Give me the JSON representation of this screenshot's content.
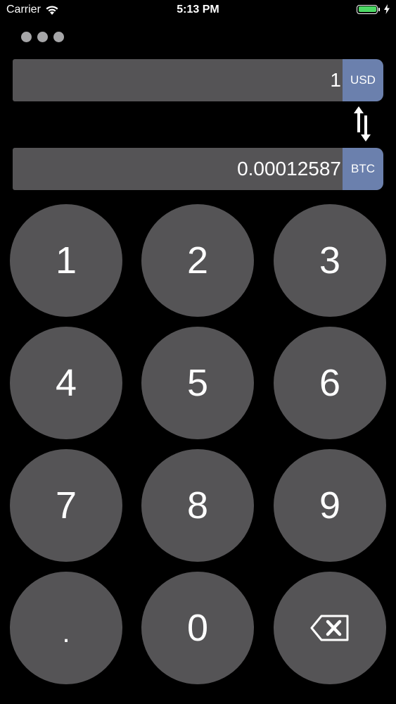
{
  "status_bar": {
    "carrier": "Carrier",
    "time": "5:13 PM",
    "battery_level": 1.0,
    "battery_color": "#4cd964",
    "wifi_icon": "wifi-icon",
    "charging_icon": "bolt-icon"
  },
  "menu": {
    "icon": "more-dots-icon"
  },
  "converter": {
    "from": {
      "value": "1",
      "currency": "USD"
    },
    "swap_icon": "swap-arrows-icon",
    "to": {
      "value": "0.00012587",
      "currency": "BTC"
    }
  },
  "keypad": {
    "keys": [
      "1",
      "2",
      "3",
      "4",
      "5",
      "6",
      "7",
      "8",
      "9",
      ".",
      "0"
    ],
    "backspace_icon": "backspace-icon"
  },
  "colors": {
    "background": "#000000",
    "field": "#555456",
    "key": "#555456",
    "currency_tag": "#6b80ad",
    "dots": "#a6a6a8"
  }
}
